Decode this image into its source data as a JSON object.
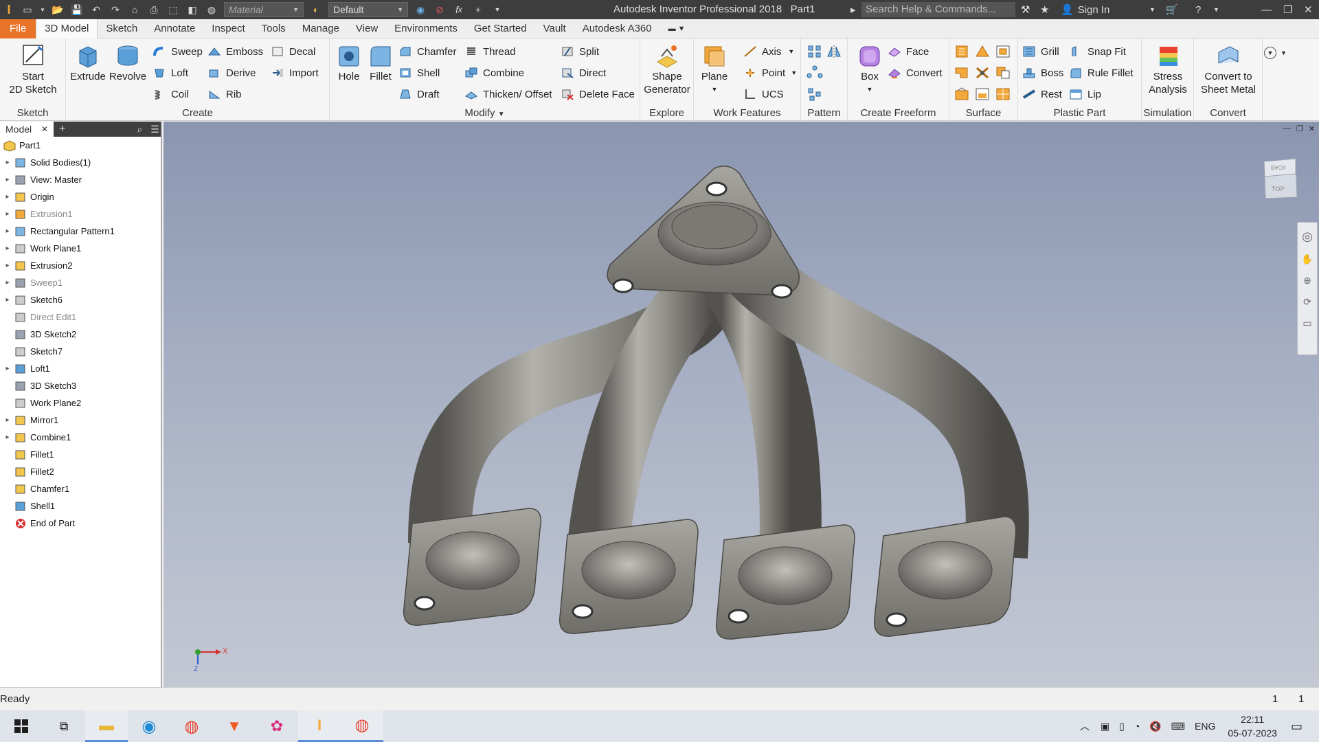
{
  "titlebar": {
    "material_placeholder": "Material",
    "appearance_value": "Default",
    "app_title": "Autodesk Inventor Professional 2018",
    "document_name": "Part1",
    "search_placeholder": "Search Help & Commands...",
    "sign_in": "Sign In"
  },
  "menu": {
    "tabs": [
      "File",
      "3D Model",
      "Sketch",
      "Annotate",
      "Inspect",
      "Tools",
      "Manage",
      "View",
      "Environments",
      "Get Started",
      "Vault",
      "Autodesk A360"
    ]
  },
  "ribbon": {
    "sketch": {
      "start_sketch": "Start\n2D Sketch",
      "label": "Sketch"
    },
    "create": {
      "extrude": "Extrude",
      "revolve": "Revolve",
      "sweep": "Sweep",
      "emboss": "Emboss",
      "decal": "Decal",
      "loft": "Loft",
      "derive": "Derive",
      "import": "Import",
      "coil": "Coil",
      "rib": "Rib",
      "label": "Create"
    },
    "modify": {
      "hole": "Hole",
      "fillet": "Fillet",
      "chamfer": "Chamfer",
      "thread": "Thread",
      "split": "Split",
      "shell": "Shell",
      "combine": "Combine",
      "direct": "Direct",
      "draft": "Draft",
      "thicken": "Thicken/ Offset",
      "delete_face": "Delete Face",
      "label": "Modify"
    },
    "explore": {
      "shape_generator": "Shape\nGenerator",
      "label": "Explore"
    },
    "work_features": {
      "plane": "Plane",
      "axis": "Axis",
      "point": "Point",
      "ucs": "UCS",
      "label": "Work Features"
    },
    "pattern": {
      "label": "Pattern"
    },
    "freeform": {
      "box": "Box",
      "face": "Face",
      "convert": "Convert",
      "label": "Create Freeform"
    },
    "surface": {
      "label": "Surface"
    },
    "plastic": {
      "grill": "Grill",
      "snap_fit": "Snap Fit",
      "boss": "Boss",
      "rule_fillet": "Rule Fillet",
      "rest": "Rest",
      "lip": "Lip",
      "label": "Plastic Part"
    },
    "simulation": {
      "stress": "Stress\nAnalysis",
      "label": "Simulation"
    },
    "convert": {
      "sheet_metal": "Convert to\nSheet Metal",
      "label": "Convert"
    }
  },
  "browser": {
    "tab_label": "Model",
    "root": "Part1",
    "items": [
      {
        "label": "Solid Bodies(1)",
        "expand": true,
        "dim": false
      },
      {
        "label": "View: Master",
        "expand": true,
        "dim": false
      },
      {
        "label": "Origin",
        "expand": true,
        "dim": false
      },
      {
        "label": "Extrusion1",
        "expand": true,
        "dim": true
      },
      {
        "label": "Rectangular Pattern1",
        "expand": true,
        "dim": false
      },
      {
        "label": "Work Plane1",
        "expand": true,
        "dim": false
      },
      {
        "label": "Extrusion2",
        "expand": true,
        "dim": false
      },
      {
        "label": "Sweep1",
        "expand": true,
        "dim": true
      },
      {
        "label": "Sketch6",
        "expand": true,
        "dim": false
      },
      {
        "label": "Direct Edit1",
        "expand": false,
        "dim": true
      },
      {
        "label": "3D Sketch2",
        "expand": false,
        "dim": false
      },
      {
        "label": "Sketch7",
        "expand": false,
        "dim": false
      },
      {
        "label": "Loft1",
        "expand": true,
        "dim": false
      },
      {
        "label": "3D Sketch3",
        "expand": false,
        "dim": false
      },
      {
        "label": "Work Plane2",
        "expand": false,
        "dim": false
      },
      {
        "label": "Mirror1",
        "expand": true,
        "dim": false
      },
      {
        "label": "Combine1",
        "expand": true,
        "dim": false
      },
      {
        "label": "Fillet1",
        "expand": false,
        "dim": false
      },
      {
        "label": "Fillet2",
        "expand": false,
        "dim": false
      },
      {
        "label": "Chamfer1",
        "expand": false,
        "dim": false
      },
      {
        "label": "Shell1",
        "expand": false,
        "dim": false
      },
      {
        "label": "End of Part",
        "expand": false,
        "dim": false
      }
    ]
  },
  "viewport": {
    "viewcube_top": "TOP",
    "viewcube_back": "BACK",
    "axis_x": "X",
    "axis_z": "Z"
  },
  "status": {
    "text": "Ready",
    "count1": "1",
    "count2": "1"
  },
  "taskbar": {
    "language": "ENG",
    "time": "22:11",
    "date": "05-07-2023"
  },
  "colors": {
    "file_tab": "#e8742a",
    "titlebar": "#3d3d3d",
    "viewport_top": "#8a95b0",
    "viewport_bottom": "#c3c8d3",
    "part_metal": "#8e8c86"
  }
}
